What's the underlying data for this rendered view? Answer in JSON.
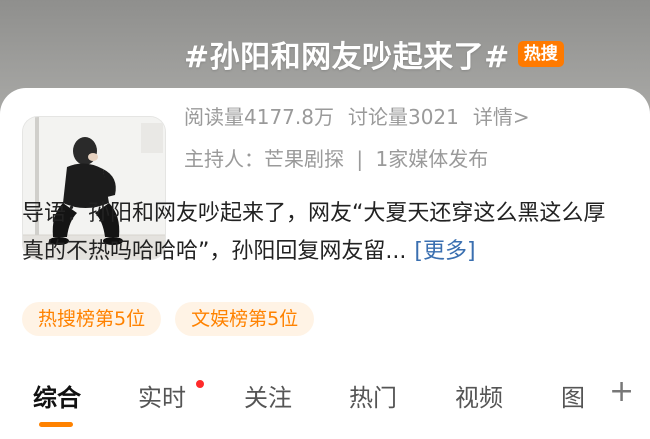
{
  "topic": {
    "title": "#孙阳和网友吵起来了#",
    "badge": "热搜"
  },
  "stats": {
    "reads": "阅读量4177.8万",
    "discussions": "讨论量3021",
    "details": "详情>"
  },
  "host_line": {
    "host": "主持人：芒果剧探",
    "separator": "|",
    "media": "1家媒体发布"
  },
  "intro": {
    "text": "导语：孙阳和网友吵起来了，网友“大夏天还穿这么黑这么厚真的不热吗哈哈哈”，孙阳回复网友留...",
    "more": "[更多]"
  },
  "tags": [
    "热搜榜第5位",
    "文娱榜第5位"
  ],
  "tabs": [
    "综合",
    "实时",
    "关注",
    "热门",
    "视频",
    "图"
  ],
  "active_tab": "综合",
  "plus_label": "+",
  "colors": {
    "accent": "#ff8200",
    "badge": "#ff7a00",
    "link": "#3a6fb0"
  }
}
